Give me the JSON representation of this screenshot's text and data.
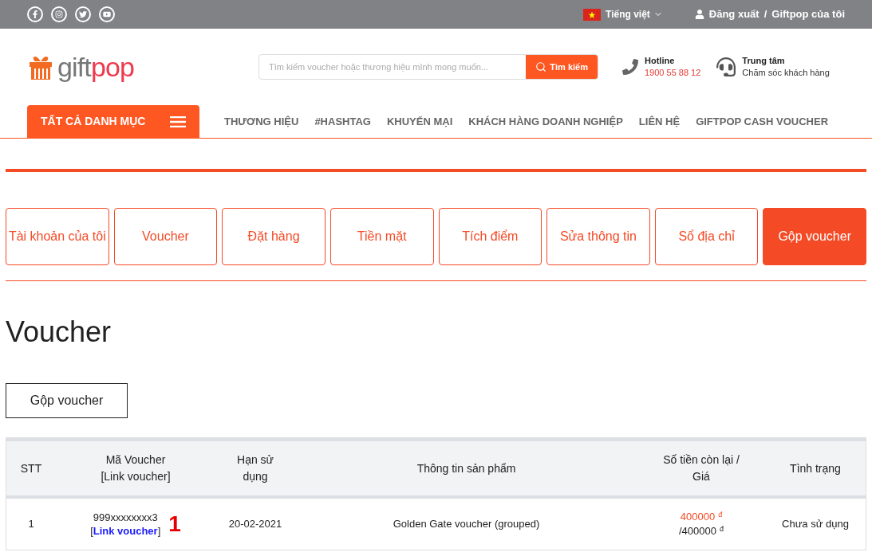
{
  "top_bar": {
    "language": "Tiếng việt",
    "logout": "Đăng xuất",
    "separator": "/",
    "account": "Giftpop của tôi"
  },
  "header": {
    "logo": {
      "gift": "gift",
      "pop": "pop"
    },
    "search": {
      "placeholder": "Tìm kiếm voucher hoặc thương hiệu mình mong muốn...",
      "button": "Tìm kiếm"
    },
    "hotline": {
      "label": "Hotline",
      "number": "1900 55 88 12"
    },
    "support": {
      "title": "Trung tâm",
      "subtitle": "Chăm sóc khách hàng"
    }
  },
  "nav": {
    "all_categories": "TẤT CẢ DANH MỤC",
    "items": [
      "THƯƠNG HIỆU",
      "#HASHTAG",
      "KHUYẾN MẠI",
      "KHÁCH HÀNG DOANH NGHIỆP",
      "LIÊN HỆ",
      "GIFTPOP CASH VOUCHER"
    ]
  },
  "tabs": [
    {
      "label": "Tài khoản của tôi",
      "selected": false
    },
    {
      "label": "Voucher",
      "selected": false
    },
    {
      "label": "Đặt hàng",
      "selected": false
    },
    {
      "label": "Tiền mặt",
      "selected": false
    },
    {
      "label": "Tích điểm",
      "selected": false
    },
    {
      "label": "Sửa thông tin",
      "selected": false
    },
    {
      "label": "Sổ địa chỉ",
      "selected": false
    },
    {
      "label": "Gộp voucher",
      "selected": true
    }
  ],
  "page_title": "Voucher",
  "merge_button": "Gộp voucher",
  "table": {
    "columns": [
      "STT",
      "Mã Voucher [Link voucher]",
      "Hạn sử dụng",
      "Thông tin sản phẩm",
      "Số tiền còn lại / Giá",
      "Tình trạng"
    ],
    "rows": [
      {
        "stt": "1",
        "code": "999xxxxxxxx3",
        "link_open": "[",
        "link": "Link voucher",
        "link_close": "]",
        "annotation": "1",
        "expiry": "20-02-2021",
        "product": "Golden Gate voucher (grouped)",
        "remaining": "400000",
        "remaining_currency": "đ",
        "price": "/400000",
        "price_currency": "đ",
        "status": "Chưa sử dụng"
      }
    ]
  }
}
